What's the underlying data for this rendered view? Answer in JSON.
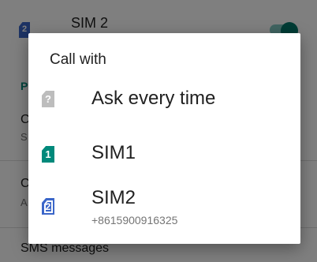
{
  "background": {
    "sim2_row": {
      "sim_number": "2",
      "label": "SIM 2",
      "toggle_on": true
    },
    "partial_letters": [
      "P",
      "C",
      "S",
      "C",
      "A"
    ],
    "sms_label": "SMS messages"
  },
  "dialog": {
    "title": "Call with",
    "options": [
      {
        "label": "Ask every time",
        "icon": "sim-question-icon",
        "icon_text": "?"
      },
      {
        "label": "SIM1",
        "icon": "sim1-card-icon",
        "icon_text": "1"
      },
      {
        "label": "SIM2",
        "sub": "+8615900916325",
        "icon": "sim2-card-icon",
        "icon_text": "2"
      }
    ]
  },
  "colors": {
    "accent": "#00796b",
    "sim1": "#00897b",
    "sim2": "#3b66c9",
    "ask": "#bdbdbd"
  }
}
